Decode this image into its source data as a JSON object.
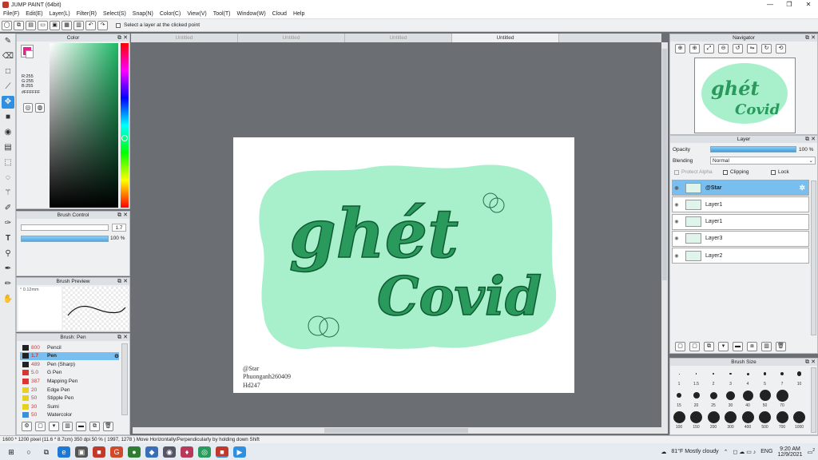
{
  "app": {
    "title": "JUMP PAINT (64bit)"
  },
  "menu": [
    "File(F)",
    "Edit(E)",
    "Layer(L)",
    "Filter(R)",
    "Select(S)",
    "Snap(N)",
    "Color(C)",
    "View(V)",
    "Tool(T)",
    "Window(W)",
    "Cloud",
    "Help"
  ],
  "toolbar": {
    "hint": "Select a layer at the clicked point"
  },
  "tabs": [
    "Untitled",
    "Untitled",
    "Untitled",
    "Untitled"
  ],
  "color": {
    "title": "Color",
    "r": "R:255",
    "g": "G:255",
    "b": "B:255",
    "hex": "#FFFFFF"
  },
  "brush_control": {
    "title": "Brush Control",
    "size": "1.7",
    "opacity": "100 %"
  },
  "brush_preview": {
    "title": "Brush Preview",
    "size": "0.12mm"
  },
  "brush_list": {
    "title": "Brush: Pen",
    "items": [
      {
        "num": "800",
        "name": "Pencil",
        "color": "#222"
      },
      {
        "num": "1.7",
        "name": "Pen",
        "color": "#222",
        "selected": true
      },
      {
        "num": "489",
        "name": "Pen (Sharp)",
        "color": "#222"
      },
      {
        "num": "5.0",
        "name": "G Pen",
        "color": "#d33"
      },
      {
        "num": "387",
        "name": "Mapping Pen",
        "color": "#d33"
      },
      {
        "num": "20",
        "name": "Edge Pen",
        "color": "#e8d020"
      },
      {
        "num": "50",
        "name": "Stipple Pen",
        "color": "#e8d020"
      },
      {
        "num": "30",
        "name": "Sumi",
        "color": "#e8d020"
      },
      {
        "num": "50",
        "name": "Watercolor",
        "color": "#3a8fd8"
      }
    ]
  },
  "artwork": {
    "line1": "ghét",
    "line2": "Covid",
    "credit1": "@Star",
    "credit2": "Phuonganh260409",
    "credit3": "Hd247"
  },
  "navigator": {
    "title": "Navigator"
  },
  "layer_panel": {
    "title": "Layer",
    "opacity_label": "Opacity",
    "opacity_value": "100 %",
    "blending_label": "Blending",
    "blending_value": "Normal",
    "protect_alpha": "Protect Alpha",
    "clipping": "Clipping",
    "lock": "Lock",
    "layers": [
      {
        "name": "@Star",
        "selected": true
      },
      {
        "name": "Layer1"
      },
      {
        "name": "Layer1"
      },
      {
        "name": "Layer3"
      },
      {
        "name": "Layer2"
      }
    ]
  },
  "brush_size": {
    "title": "Brush Size",
    "labels": [
      "1",
      "1.5",
      "2",
      "3",
      "4",
      "5",
      "7",
      "10",
      "15",
      "20",
      "25",
      "30",
      "40",
      "50",
      "70",
      "100",
      "150",
      "200",
      "300",
      "400",
      "500",
      "700",
      "1000"
    ]
  },
  "status": {
    "text": "1600 * 1200 pixel  (11.6 * 8.7cm)  350 dpi  50 %  ( 1997, 1278 )  Move Horizontally/Perpendicularly by holding down Shift"
  },
  "taskbar": {
    "weather": "81°F  Mostly cloudy",
    "lang": "ENG",
    "time": "9:20 AM",
    "date": "12/9/2021",
    "badge": "2"
  },
  "colors": {
    "accent": "#2f8fe0",
    "mint": "#a8f0cc",
    "green": "#2a9a5c"
  }
}
